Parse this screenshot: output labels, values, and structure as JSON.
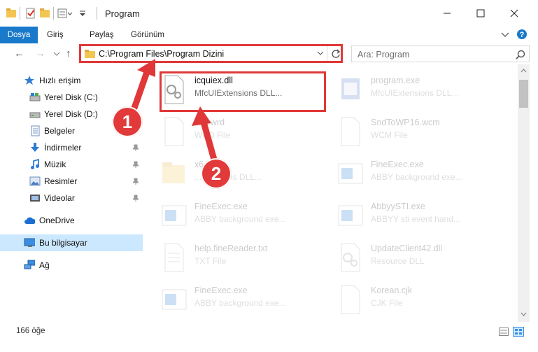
{
  "window": {
    "title": "Program"
  },
  "ribbon": {
    "tabs": [
      {
        "label": "Dosya"
      },
      {
        "label": "Giriş"
      },
      {
        "label": "Paylaş"
      },
      {
        "label": "Görünüm"
      }
    ]
  },
  "address": {
    "path": "C:\\Program Files\\Program Dizini"
  },
  "search": {
    "placeholder": "Ara: Program"
  },
  "nav": {
    "items": [
      {
        "label": "Hızlı erişim"
      },
      {
        "label": "Yerel Disk (C:)"
      },
      {
        "label": "Yerel Disk (D:)"
      },
      {
        "label": "Belgeler"
      },
      {
        "label": "İndirmeler"
      },
      {
        "label": "Müzik"
      },
      {
        "label": "Resimler"
      },
      {
        "label": "Videolar"
      },
      {
        "label": "OneDrive"
      },
      {
        "label": "Bu bilgisayar"
      },
      {
        "label": "Ağ"
      }
    ]
  },
  "files": [
    {
      "name": "icquiex.dll",
      "type": "MfcUIExtensions DLL..."
    },
    {
      "name": "program.exe",
      "type": "MfcUIExtensions DLL..."
    },
    {
      "name": "...ic.wrd",
      "type": "WRD File"
    },
    {
      "name": "SndToWP16.wcm",
      "type": "WCM File"
    },
    {
      "name": "x6...",
      "type": "...xtensions DLL..."
    },
    {
      "name": "FineExec.exe",
      "type": "ABBY background exe..."
    },
    {
      "name": "FineExec.exe",
      "type": "ABBY background exe..."
    },
    {
      "name": "AbbyySTI.exe",
      "type": "ABBYY sti event hand..."
    },
    {
      "name": "help.fineReader.txt",
      "type": "TXT File"
    },
    {
      "name": "UpdateClient42.dll",
      "type": "Resource DLL"
    },
    {
      "name": "FineExec.exe",
      "type": "ABBY background exe..."
    },
    {
      "name": "Korean.cjk",
      "type": "CJK File"
    }
  ],
  "status": {
    "count": "166 öğe"
  },
  "annotations": {
    "step1": "1",
    "step2": "2"
  },
  "colors": {
    "accent": "#1979ca",
    "highlight": "#e03838",
    "selected": "#cce8ff"
  }
}
